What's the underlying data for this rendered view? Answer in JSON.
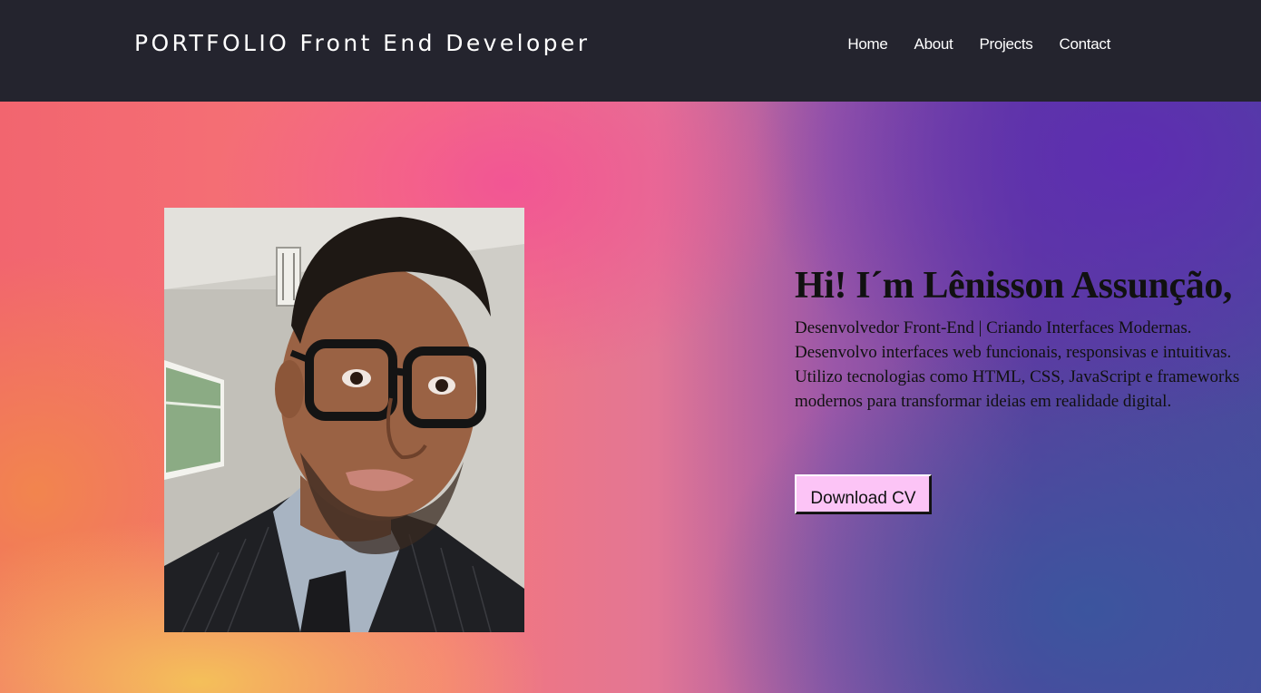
{
  "header": {
    "brand": "PORTFOLIO Front End Developer",
    "nav": [
      "Home",
      "About",
      "Projects",
      "Contact"
    ]
  },
  "hero": {
    "headline": "Hi! I´m Lênisson Assunção,",
    "description_lines": [
      "Desenvolvedor Front-End | Criando Interfaces Modernas.",
      "Desenvolvo interfaces web funcionais, responsivas e intuitivas.",
      "Utilizo tecnologias como HTML, CSS, JavaScript e frameworks",
      "modernos para transformar ideias em realidade digital."
    ],
    "button_label": "Download CV"
  },
  "colors": {
    "header_bg": "#24242e",
    "button_bg": "#fcc4f6"
  }
}
